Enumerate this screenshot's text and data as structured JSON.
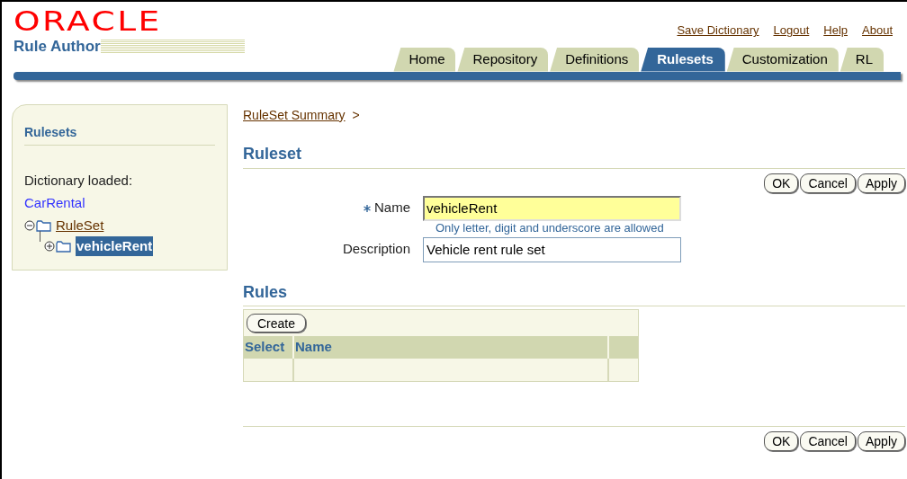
{
  "header": {
    "brand": "ORACLE",
    "product": "Rule Author"
  },
  "global_links": [
    "Save Dictionary",
    "Logout",
    "Help",
    "About"
  ],
  "tabs": [
    {
      "label": "Home",
      "selected": false
    },
    {
      "label": "Repository",
      "selected": false
    },
    {
      "label": "Definitions",
      "selected": false
    },
    {
      "label": "Rulesets",
      "selected": true
    },
    {
      "label": "Customization",
      "selected": false
    },
    {
      "label": "RL",
      "selected": false
    }
  ],
  "sidebar": {
    "title": "Rulesets",
    "dictionary_label": "Dictionary loaded:",
    "dictionary_name": "CarRental",
    "tree": [
      {
        "label": "RuleSet",
        "expanded": true,
        "selected": false,
        "children": [
          {
            "label": "vehicleRent",
            "expanded": false,
            "selected": true
          }
        ]
      }
    ]
  },
  "breadcrumb": {
    "link": "RuleSet Summary",
    "separator": ">"
  },
  "ruleset": {
    "title": "Ruleset",
    "buttons": [
      "OK",
      "Cancel",
      "Apply"
    ],
    "fields": [
      {
        "label": "Name",
        "required": true,
        "value": "vehicleRent",
        "focused": true,
        "hint": "Only letter, digit and underscore are allowed"
      },
      {
        "label": "Description",
        "required": false,
        "value": "Vehicle rent rule set",
        "focused": false
      }
    ]
  },
  "rules": {
    "title": "Rules",
    "create_button": "Create",
    "columns": [
      "Select",
      "Name"
    ]
  },
  "footer_buttons": [
    "OK",
    "Cancel",
    "Apply"
  ]
}
